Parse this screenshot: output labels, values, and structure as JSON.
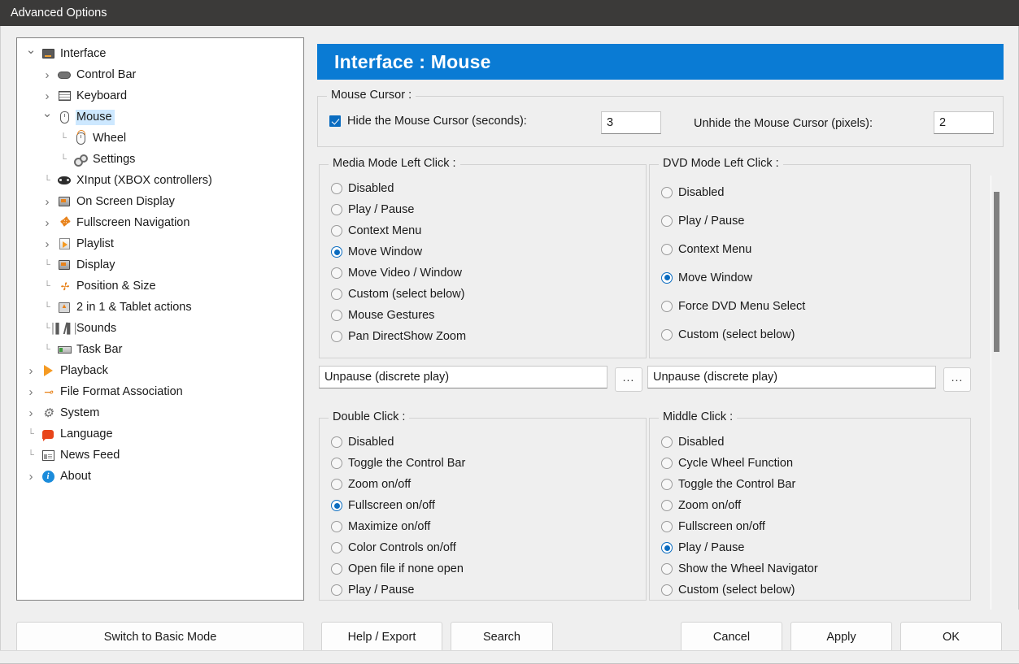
{
  "window": {
    "title": "Advanced Options"
  },
  "tree": {
    "items": [
      {
        "label": "Interface",
        "depth": 0,
        "toggle": "down",
        "icon": "monitor-icon",
        "selected": false
      },
      {
        "label": "Control Bar",
        "depth": 1,
        "toggle": "right",
        "icon": "pill-icon",
        "selected": false
      },
      {
        "label": "Keyboard",
        "depth": 1,
        "toggle": "right",
        "icon": "keyboard-icon",
        "selected": false
      },
      {
        "label": "Mouse",
        "depth": 1,
        "toggle": "down",
        "icon": "mouse-icon",
        "selected": true
      },
      {
        "label": "Wheel",
        "depth": 2,
        "toggle": "none",
        "icon": "mouse-wheel-icon",
        "selected": false
      },
      {
        "label": "Settings",
        "depth": 2,
        "toggle": "none",
        "icon": "gears-icon",
        "selected": false
      },
      {
        "label": "XInput (XBOX controllers)",
        "depth": 1,
        "toggle": "none",
        "icon": "gamepad-icon",
        "selected": false
      },
      {
        "label": "On Screen Display",
        "depth": 1,
        "toggle": "right",
        "icon": "osd-icon",
        "selected": false
      },
      {
        "label": "Fullscreen Navigation",
        "depth": 1,
        "toggle": "right",
        "icon": "fullscreen-nav-icon",
        "selected": false
      },
      {
        "label": "Playlist",
        "depth": 1,
        "toggle": "right",
        "icon": "playlist-icon",
        "selected": false
      },
      {
        "label": "Display",
        "depth": 1,
        "toggle": "none",
        "icon": "display-icon",
        "selected": false
      },
      {
        "label": "Position & Size",
        "depth": 1,
        "toggle": "none",
        "icon": "position-size-icon",
        "selected": false
      },
      {
        "label": "2 in 1 & Tablet actions",
        "depth": 1,
        "toggle": "none",
        "icon": "tablet-icon",
        "selected": false
      },
      {
        "label": "Sounds",
        "depth": 1,
        "toggle": "none",
        "icon": "waveform-icon",
        "selected": false
      },
      {
        "label": "Task Bar",
        "depth": 1,
        "toggle": "none",
        "icon": "taskbar-icon",
        "selected": false
      },
      {
        "label": "Playback",
        "depth": 0,
        "toggle": "right",
        "icon": "play-icon",
        "selected": false
      },
      {
        "label": "File Format Association",
        "depth": 0,
        "toggle": "right",
        "icon": "file-assoc-icon",
        "selected": false
      },
      {
        "label": "System",
        "depth": 0,
        "toggle": "right",
        "icon": "cog-icon",
        "selected": false
      },
      {
        "label": "Language",
        "depth": 0,
        "toggle": "none",
        "icon": "speech-bubble-icon",
        "selected": false
      },
      {
        "label": "News Feed",
        "depth": 0,
        "toggle": "none",
        "icon": "news-icon",
        "selected": false
      },
      {
        "label": "About",
        "depth": 0,
        "toggle": "right",
        "icon": "info-icon",
        "selected": false
      }
    ]
  },
  "page": {
    "header": "Interface : Mouse",
    "header_color": "#0a7bd4"
  },
  "mouse_cursor": {
    "title": "Mouse Cursor :",
    "hide_label": "Hide the Mouse Cursor (seconds):",
    "hide_checked": true,
    "hide_value": "3",
    "unhide_label": "Unhide the Mouse Cursor (pixels):",
    "unhide_value": "2"
  },
  "media_mode": {
    "title": "Media Mode Left Click :",
    "options": [
      "Disabled",
      "Play / Pause",
      "Context Menu",
      "Move Window",
      "Move Video / Window",
      "Custom (select below)",
      "Mouse Gestures",
      "Pan DirectShow Zoom"
    ],
    "selected_index": 3,
    "custom_value": "Unpause (discrete play)",
    "browse_label": "..."
  },
  "dvd_mode": {
    "title": "DVD Mode Left Click :",
    "options": [
      "Disabled",
      "Play / Pause",
      "Context Menu",
      "Move Window",
      "Force DVD Menu Select",
      "Custom (select below)"
    ],
    "selected_index": 3,
    "custom_value": "Unpause (discrete play)",
    "browse_label": "..."
  },
  "double_click": {
    "title": "Double Click :",
    "options": [
      "Disabled",
      "Toggle the Control Bar",
      "Zoom on/off",
      "Fullscreen on/off",
      "Maximize on/off",
      "Color Controls on/off",
      "Open file if none open",
      "Play / Pause"
    ],
    "selected_index": 3
  },
  "middle_click": {
    "title": "Middle Click :",
    "options": [
      "Disabled",
      "Cycle Wheel Function",
      "Toggle the Control Bar",
      "Zoom on/off",
      "Fullscreen on/off",
      "Play / Pause",
      "Show the Wheel Navigator",
      "Custom (select below)"
    ],
    "selected_index": 5
  },
  "buttons": {
    "switch_mode": "Switch to Basic Mode",
    "help_export": "Help / Export",
    "search": "Search",
    "cancel": "Cancel",
    "apply": "Apply",
    "ok": "OK"
  }
}
